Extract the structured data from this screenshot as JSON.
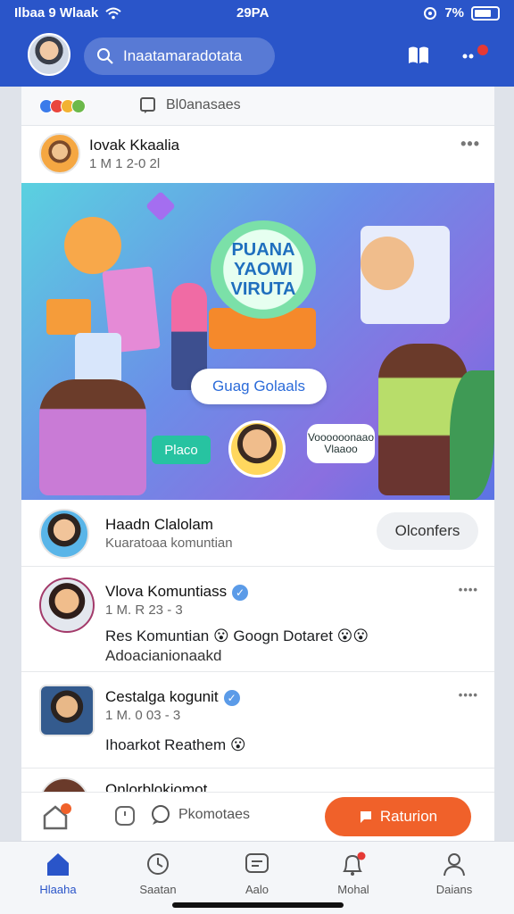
{
  "status_bar": {
    "carrier": "Ilbaa 9 Wlaak",
    "time": "29PA",
    "battery": "7%"
  },
  "header": {
    "search_placeholder": "Inaatamaradotata"
  },
  "reaction_bar": {
    "label": "Bl0anasaes"
  },
  "post": {
    "author": "Iovak Kkaalia",
    "meta": "1 M 1 2-0 2l",
    "banner": {
      "title_lines": [
        "PUANA",
        "YAOWI",
        "VIRUTA"
      ],
      "pill": "Guag Golaals",
      "small_button": "Placo",
      "bubble": "Voooooonaao Vlaaoo"
    }
  },
  "suggestion": {
    "name": "Haadn Clalolam",
    "subtitle": "Kuaratoaa komuntian",
    "follow_label": "Olconfers"
  },
  "comments": [
    {
      "name": "Vlova Komuntiass",
      "time": "1 M. R 23 - 3",
      "text_line1": "Res Komuntian",
      "text_line1b": "Googn Dotaret",
      "text_line2": "Adoacianionaakd"
    },
    {
      "name": "Cestalga kogunit",
      "time": "1 M. 0 03 - 3",
      "text_line1": "Ihoarkot Reathem"
    },
    {
      "name": "Onlorblokiomot"
    }
  ],
  "action_bar": {
    "comment_label": "Pkomotaes",
    "return_label": "Raturion"
  },
  "tabs": [
    {
      "label": "Hlaaha",
      "icon": "home-icon",
      "active": true
    },
    {
      "label": "Saatan",
      "icon": "clock-icon",
      "active": false
    },
    {
      "label": "Aalo",
      "icon": "message-icon",
      "active": false
    },
    {
      "label": "Mohal",
      "icon": "bell-icon",
      "active": false
    },
    {
      "label": "Daians",
      "icon": "profile-icon",
      "active": false
    }
  ],
  "colors": {
    "header": "#2a55c9",
    "accent": "#f0612a",
    "verified": "#5b9be8"
  }
}
